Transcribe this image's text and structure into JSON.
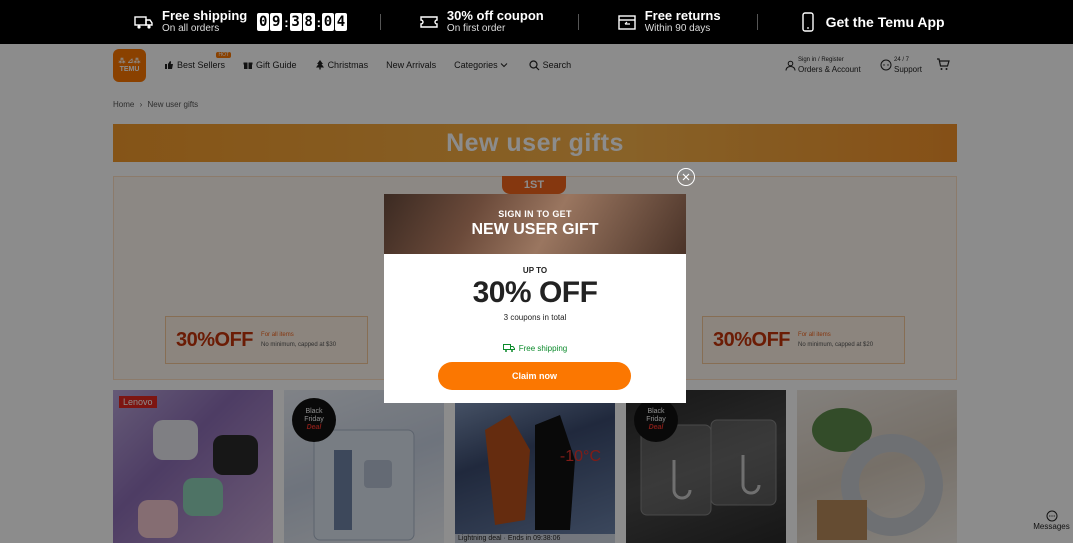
{
  "promo_bar": {
    "free_shipping_title": "Free shipping",
    "free_shipping_sub": "On all orders",
    "countdown": [
      "0",
      "9",
      ":",
      "3",
      "8",
      ":",
      "0",
      "4"
    ],
    "coupon_title": "30% off coupon",
    "coupon_sub": "On first order",
    "returns_title": "Free returns",
    "returns_sub": "Within 90 days",
    "app_label": "Get the Temu App"
  },
  "header": {
    "logo_line1": "⁂ ⊿⁂",
    "logo_line2": "TEMU",
    "nav": [
      {
        "label": "Best Sellers",
        "badge": "HOT"
      },
      {
        "label": "Gift Guide"
      },
      {
        "label": "Christmas"
      },
      {
        "label": "New Arrivals"
      },
      {
        "label": "Categories"
      },
      {
        "label": "Search"
      }
    ],
    "account_small": "Sign in / Register",
    "account_main": "Orders & Account",
    "support_small": "24 / 7",
    "support_main": "Support"
  },
  "breadcrumb": {
    "home": "Home",
    "sep": "›",
    "current": "New user gifts"
  },
  "banner": {
    "title": "New user gifts"
  },
  "gift_panel": {
    "first_tag": "1ST",
    "coupons": [
      {
        "amount": "30%OFF",
        "line1": "For all items",
        "line2": "No minimum, capped at $30"
      },
      {
        "amount": "30%OFF",
        "line1": "For all items",
        "line2": "No minimum, capped at $20"
      }
    ]
  },
  "products": [
    {
      "brand": "Lenovo"
    },
    {
      "badge": [
        "Black",
        "Friday",
        "Deal"
      ]
    },
    {
      "temp": "-10°C",
      "lightning": "Lightning deal · Ends in 09:38:06"
    },
    {
      "badge": [
        "Black",
        "Friday",
        "Deal"
      ]
    },
    {}
  ],
  "modal": {
    "header_small": "SIGN IN TO GET",
    "header_big": "NEW USER GIFT",
    "upto": "UP TO",
    "percent": "30% OFF",
    "coupons_total": "3 coupons in total",
    "free_shipping": "Free shipping",
    "claim_label": "Claim now"
  },
  "messages_label": "Messages",
  "colors": {
    "brand": "#fb7701",
    "green": "#0a8a2a"
  }
}
